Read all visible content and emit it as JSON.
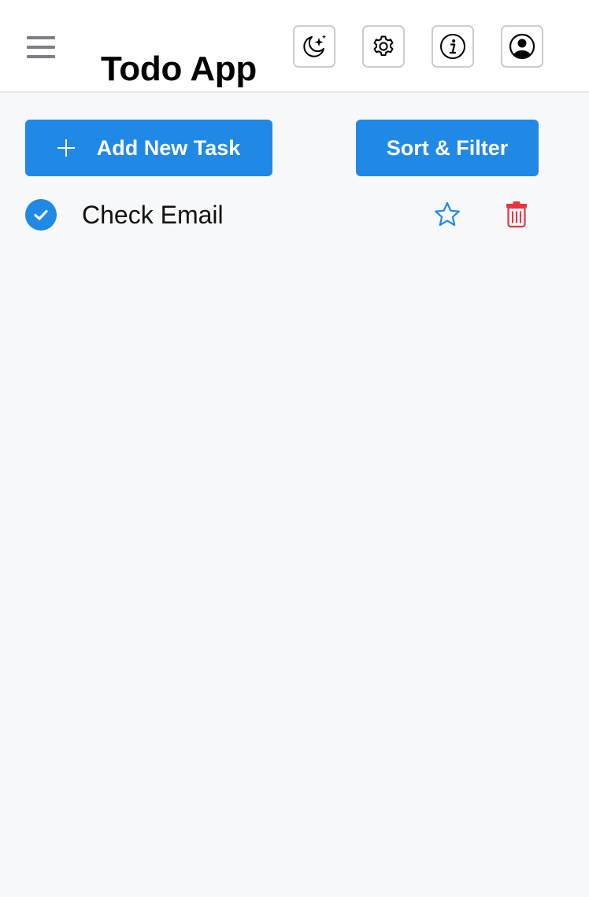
{
  "app": {
    "title": "Todo App"
  },
  "header": {
    "menu_icon": "hamburger-menu-icon",
    "icons": [
      {
        "name": "dark-mode-icon"
      },
      {
        "name": "gear-icon"
      },
      {
        "name": "info-icon"
      },
      {
        "name": "user-account-icon"
      }
    ]
  },
  "actions": {
    "add_label": "Add New Task",
    "add_icon": "plus-icon",
    "sort_label": "Sort & Filter"
  },
  "tasks": [
    {
      "label": "Check Email",
      "completed": true,
      "starred": false
    }
  ],
  "colors": {
    "accent": "#2089e5",
    "danger": "#e8343f",
    "background": "#f7f8fa",
    "header_bg": "#ffffff",
    "menu_icon": "#7c7f86"
  }
}
